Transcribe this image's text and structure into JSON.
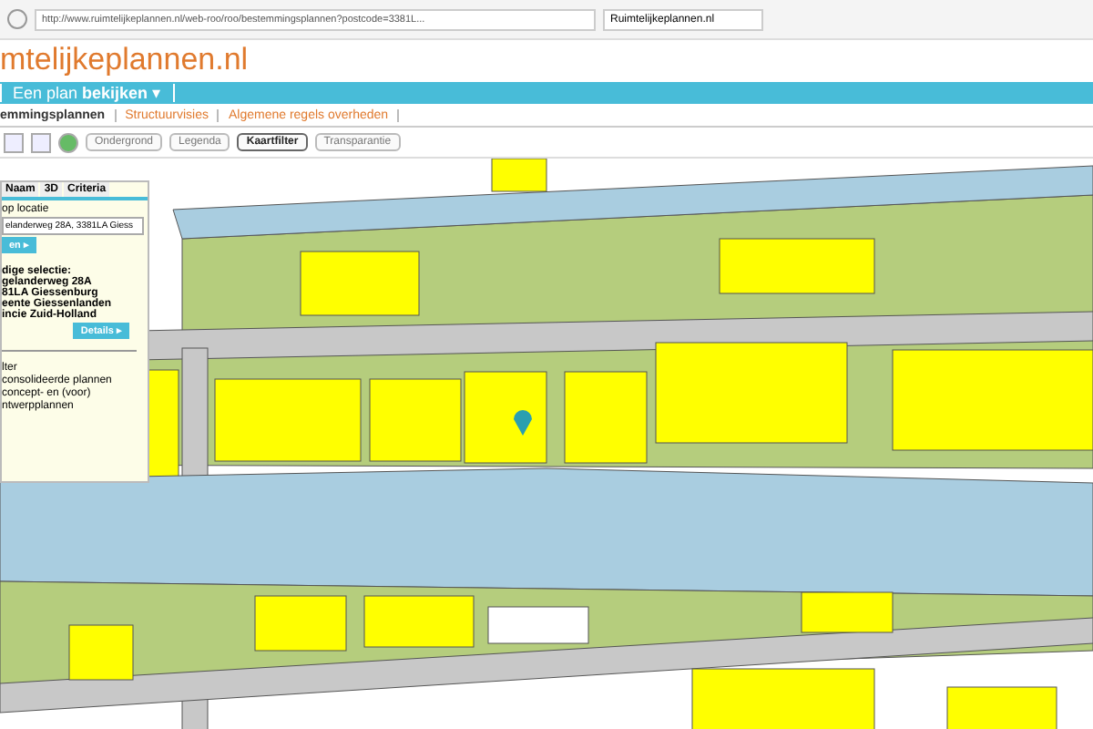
{
  "browser": {
    "url": "http://www.ruimtelijkeplannen.nl/web-roo/roo/bestemmingsplannen?postcode=3381L...",
    "tab_title": "Ruimtelijkeplannen.nl"
  },
  "site": {
    "logo": "mtelijkeplannen.nl"
  },
  "nav": {
    "label": "Een plan",
    "label_bold": "bekijken",
    "caret": "▾"
  },
  "subnav": [
    {
      "label": "emmingsplannen",
      "selected": true
    },
    {
      "label": "Structuurvisies",
      "selected": false
    },
    {
      "label": "Algemene regels overheden",
      "selected": false
    }
  ],
  "toolbar": [
    {
      "label": "Ondergrond",
      "selected": false
    },
    {
      "label": "Legenda",
      "selected": false
    },
    {
      "label": "Kaartfilter",
      "selected": true
    },
    {
      "label": "Transparantie",
      "selected": false
    }
  ],
  "panel": {
    "tabs": [
      {
        "label": "Naam",
        "selected": false
      },
      {
        "label": "3D",
        "selected": false
      },
      {
        "label": "Criteria",
        "selected": false
      }
    ],
    "location_label": "op locatie",
    "address_value": "elanderweg 28A, 3381LA Giess",
    "search_button": "en ▸",
    "selection_lines": [
      "dige selectie:",
      "gelanderweg 28A",
      "81LA Giessenburg",
      "eente Giessenlanden",
      "incie Zuid-Holland"
    ],
    "details_button": "Details ▸",
    "filter_title": "lter",
    "filter_lines": [
      "consolideerde plannen",
      "concept- en (voor)",
      "ntwerpplannen"
    ]
  }
}
